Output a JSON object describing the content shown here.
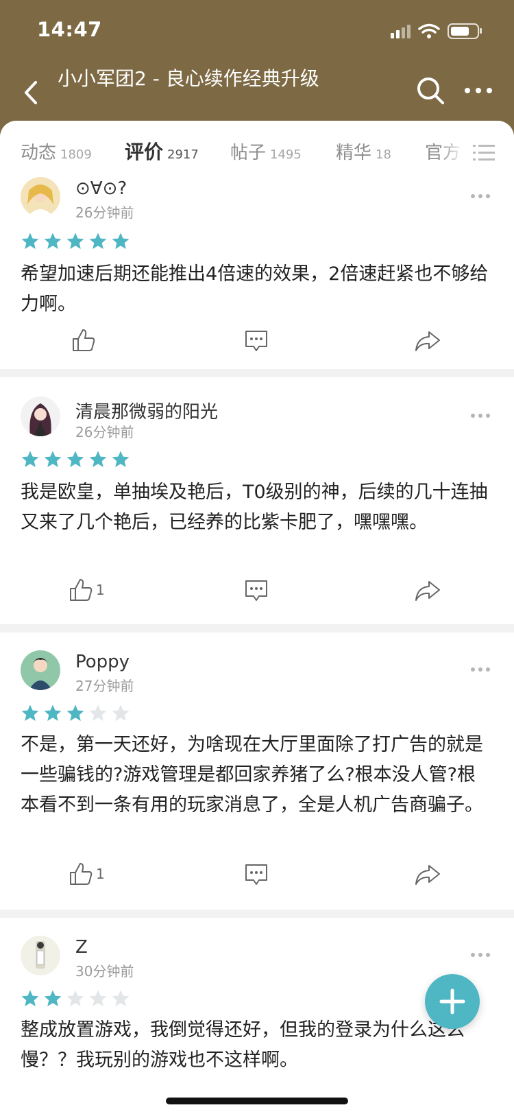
{
  "status_bar": {
    "time": "14:47"
  },
  "header": {
    "title": "小小军团2 - 良心续作经典升级"
  },
  "tabs": [
    {
      "label": "动态",
      "count": "1809"
    },
    {
      "label": "评价",
      "count": "2917"
    },
    {
      "label": "帖子",
      "count": "1495"
    },
    {
      "label": "精华",
      "count": "18"
    },
    {
      "label": "官方",
      "count": ""
    }
  ],
  "colors": {
    "header_bg": "#7d6a44",
    "accent": "#4fb6c4",
    "star_empty": "#e3e6e8"
  },
  "reviews": [
    {
      "username": "⊙∀⊙?",
      "time": "26分钟前",
      "rating": 5,
      "text": "希望加速后期还能推出4倍速的效果，2倍速赶紧也不够给力啊。",
      "likes": ""
    },
    {
      "username": "清晨那微弱的阳光",
      "time": "26分钟前",
      "rating": 5,
      "text": "我是欧皇，单抽埃及艳后，T0级别的神，后续的几十连抽又来了几个艳后，已经养的比紫卡肥了，嘿嘿嘿。",
      "likes": "1"
    },
    {
      "username": "Poppy",
      "time": "27分钟前",
      "rating": 3,
      "text": "不是，第一天还好，为啥现在大厅里面除了打广告的就是一些骗钱的?游戏管理是都回家养猪了么?根本没人管?根本看不到一条有用的玩家消息了，全是人机广告商骗子。",
      "likes": "1"
    },
    {
      "username": "Z",
      "time": "30分钟前",
      "rating": 2,
      "text": "整成放置游戏，我倒觉得还好，但我的登录为什么这么慢？？我玩别的游戏也不这样啊。",
      "likes": ""
    }
  ]
}
